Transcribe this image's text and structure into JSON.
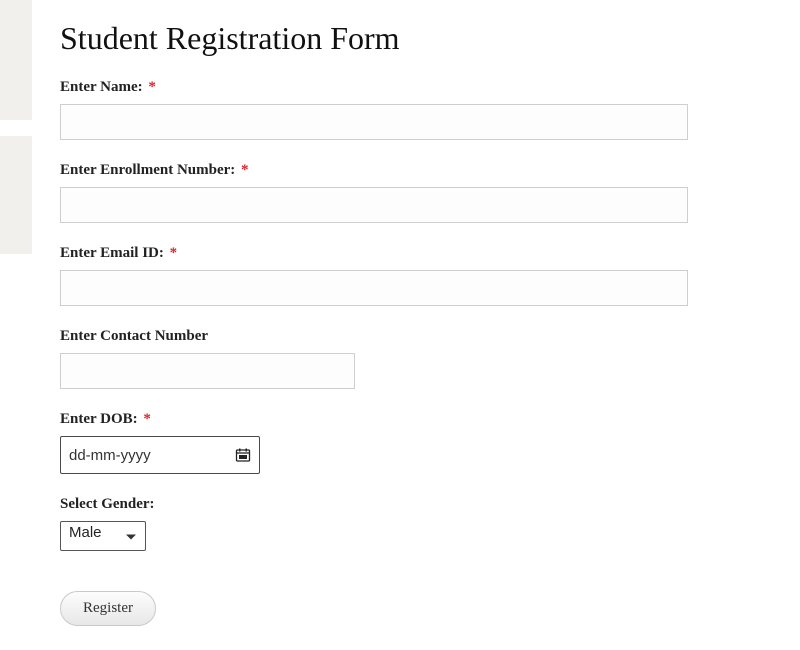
{
  "title": "Student Registration Form",
  "required_mark": "*",
  "fields": {
    "name": {
      "label": "Enter Name:",
      "required": true,
      "value": ""
    },
    "enrollment": {
      "label": "Enter Enrollment Number:",
      "required": true,
      "value": ""
    },
    "email": {
      "label": "Enter Email ID:",
      "required": true,
      "value": ""
    },
    "contact": {
      "label": "Enter Contact Number",
      "required": false,
      "value": ""
    },
    "dob": {
      "label": "Enter DOB:",
      "required": true,
      "placeholder": "dd-mm-yyyy",
      "value": ""
    },
    "gender": {
      "label": "Select Gender:",
      "required": false,
      "selected": "Male"
    }
  },
  "submit_label": "Register"
}
